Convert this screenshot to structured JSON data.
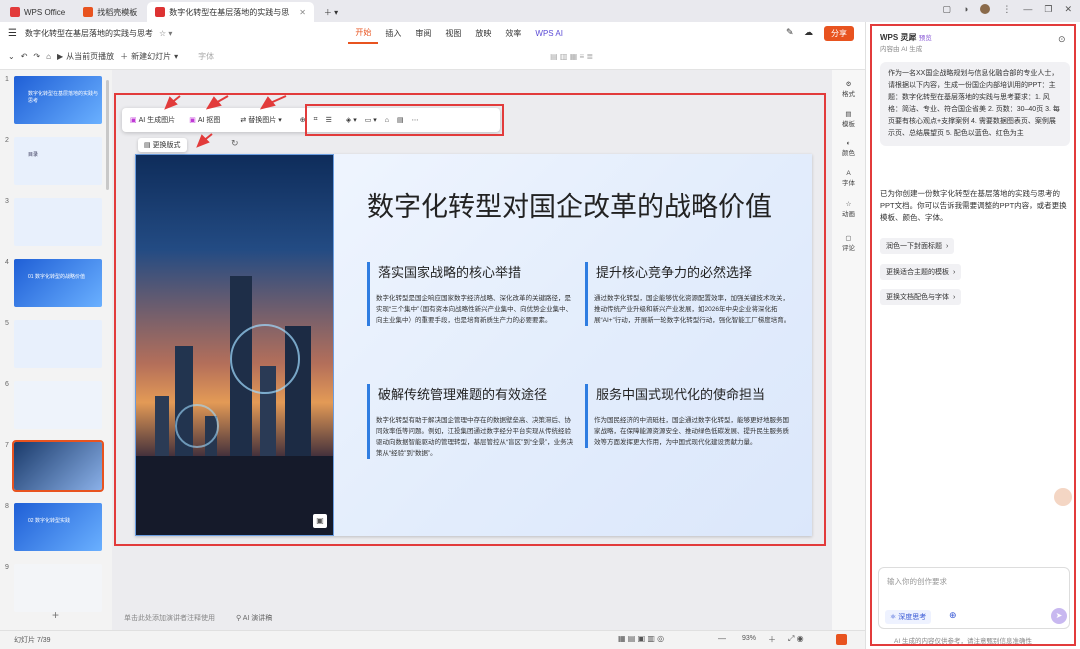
{
  "tabs": [
    {
      "label": "WPS Office",
      "color": "#e23b3b"
    },
    {
      "label": "找稻壳模板",
      "color": "#e8531f"
    },
    {
      "label": "数字化转型在基层落地的实践与思",
      "color": "#d33"
    }
  ],
  "menu": {
    "file_title": "数字化转型在基层落地的实践与思考",
    "items": [
      "开始",
      "插入",
      "审阅",
      "视图",
      "放映",
      "效率",
      "WPS AI"
    ],
    "active": "开始",
    "share": "分享"
  },
  "toolbar": {
    "play_label": "从当前页播放",
    "new_slide_label": "新建幻灯片",
    "font_label": "字体"
  },
  "floatbar": {
    "ai_gen": "AI 生成图片",
    "ai_cut": "AI 抠图",
    "replace": "替换图片",
    "change_layout": "更换版式"
  },
  "slide": {
    "title": "数字化转型对国企改革的战略价值",
    "cards": [
      {
        "heading": "落实国家战略的核心举措",
        "body": "数字化转型是国企响应国家数字经济战略、深化改革的关键路径，是实现“三个集中”（国有资本向战略性新兴产业集中、向优势企业集中、向主业集中）的重要手段，也是培育新质生产力的必要要素。"
      },
      {
        "heading": "提升核心竞争力的必然选择",
        "body": "通过数字化转型，国企能够优化资源配置效率，加强关键技术攻关，推动传统产业升级和新兴产业发展，如2026年中央企业将深化拓展“AI+”行动，开展新一轮数字化转型行动，强化智能工厂梯度培育。"
      },
      {
        "heading": "破解传统管理难题的有效途径",
        "body": "数字化转型有助于解决国企管理中存在的数据壁垒高、决策滞后、协同效率低等问题。例如，江投集团通过数字经分平台实现从传统经验驱动向数据智能驱动的管理转型，基层管控从“盲区”到“全景”，业务决策从“经验”到“数据”。"
      },
      {
        "heading": "服务中国式现代化的使命担当",
        "body": "作为国民经济的中流砥柱，国企通过数字化转型，能够更好地服务国家战略，在保障能源资源安全、推动绿色低碳发展、提升民生服务质效等方面发挥更大作用，为中国式现代化建设贡献力量。"
      }
    ]
  },
  "thumbs": [
    {
      "num": "1",
      "text": "数字化转型在基层落地的实践与思考"
    },
    {
      "num": "2",
      "text": "目录"
    },
    {
      "num": "3",
      "text": ""
    },
    {
      "num": "4",
      "text": "01 数字化转型的战略价值"
    },
    {
      "num": "5",
      "text": ""
    },
    {
      "num": "6",
      "text": ""
    },
    {
      "num": "7",
      "text": ""
    },
    {
      "num": "8",
      "text": "02 数字化转型实践"
    },
    {
      "num": "9",
      "text": ""
    }
  ],
  "strip": [
    "格式",
    "模板",
    "颜色",
    "字体",
    "动画",
    "评论"
  ],
  "notes_placeholder": "单击此处添加演讲者注释使用",
  "notes_ai": "AI 演讲稿",
  "status": {
    "slide_count": "幻灯片 7/39",
    "zoom": "93%"
  },
  "panel": {
    "title": "WPS 灵犀",
    "badge": "预览",
    "subtitle": "内容由 AI 生成",
    "user_msg": "作为一名XX国企战略规划与信息化融合部的专业人士，请根据以下内容，生成一份国企内部培训用的PPT：主题：数字化转型在基层落地的实践与思考要求：1. 风格：简洁、专业、符合国企省美 2. 页数：30–40页 3. 每页要有核心观点+支撑案例 4. 需要数据图表页、案例展示页、总结展望页 5. 配色以蓝色、红色为主",
    "reply": "已为你创建一份数字化转型在基层落地的实践与思考的PPT文档。你可以告诉我需要调整的PPT内容，或者更换模板、颜色、字体。",
    "chips": [
      "润色一下封面标题",
      "更换适合主题的模板",
      "更换文档配色与字体"
    ],
    "input_placeholder": "输入你的创作要求",
    "deep_think": "深度思考",
    "footer": "AI 生成的内容仅供参考，请注意甄别信息准确性"
  }
}
